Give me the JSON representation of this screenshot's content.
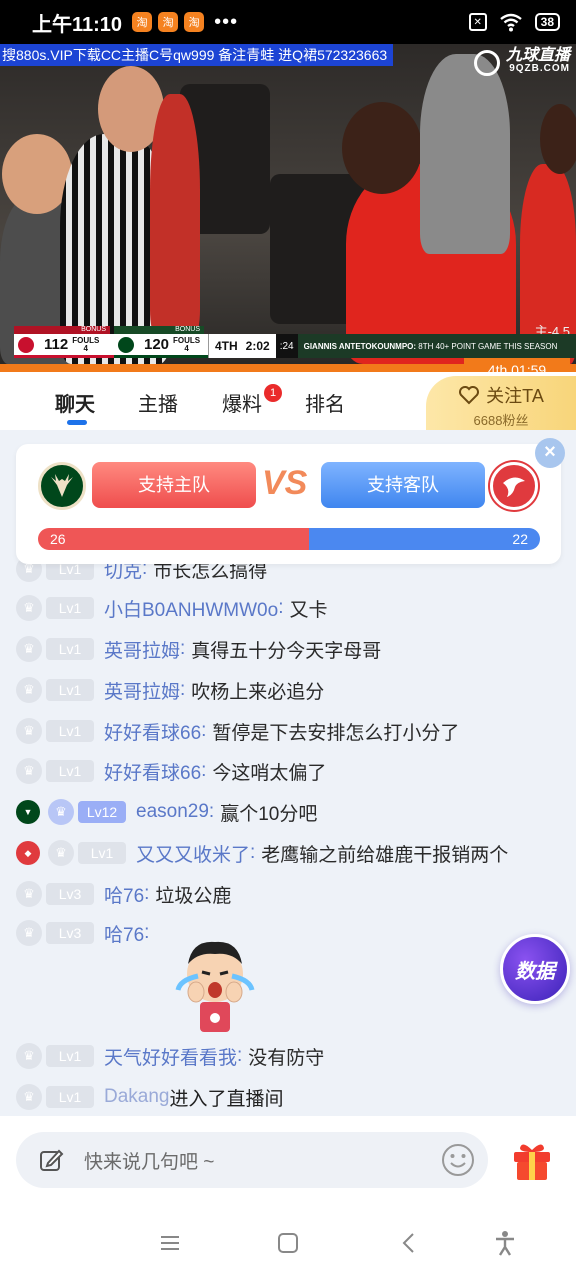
{
  "status": {
    "time": "上午11:10",
    "app_icons": [
      "淘",
      "淘",
      "淘"
    ],
    "dots": "•••",
    "battery": "38"
  },
  "video": {
    "ticker": "搜880s.VIP下载CC主播C号qw999 备注青蛙 进Q裙572323663",
    "watermark_title": "九球直播",
    "watermark_url": "9QZB.COM",
    "scorebug": {
      "away_score": "112",
      "away_fouls_label": "FOULS",
      "away_fouls": "4",
      "home_score": "120",
      "home_fouls_label": "FOULS",
      "home_fouls": "4",
      "away_bonus": "BONUS",
      "home_bonus": "BONUS",
      "period": "4TH",
      "clock": "2:02",
      "shot_clock": ":24",
      "note_name": "GIANNIS ANTETOKOUNMPO:",
      "note_text": "8TH 40+ POINT GAME THIS SEASON"
    },
    "odds": "主-4.5"
  },
  "game_clock": "4th 01:59",
  "tabs": [
    {
      "label": "聊天"
    },
    {
      "label": "主播"
    },
    {
      "label": "爆料",
      "badge": "1"
    },
    {
      "label": "排名"
    }
  ],
  "follow": {
    "label": "关注TA",
    "fans": "6688粉丝"
  },
  "vote": {
    "home_label": "支持主队",
    "away_label": "支持客队",
    "vs": "VS",
    "home_votes": "26",
    "away_votes": "22",
    "home_share": 0.54,
    "close": "×"
  },
  "messages": [
    {
      "level": "Lv1",
      "user": "切克",
      "text": "市长怎么搞得"
    },
    {
      "level": "Lv1",
      "user": "小白B0ANHWMW0o",
      "text": "又卡"
    },
    {
      "level": "Lv1",
      "user": "英哥拉姆",
      "text": "真得五十分今天字母哥"
    },
    {
      "level": "Lv1",
      "user": "英哥拉姆",
      "text": "吹杨上来必追分"
    },
    {
      "level": "Lv1",
      "user": "好好看球66",
      "text": "暂停是下去安排怎么打小分了"
    },
    {
      "level": "Lv1",
      "user": "好好看球66",
      "text": "今这哨太偏了"
    },
    {
      "level": "Lv12",
      "user": "eason29",
      "text": "赢个10分吧"
    },
    {
      "level": "Lv1",
      "user": "又又又收米了",
      "text": "老鹰输之前给雄鹿干报销两个"
    },
    {
      "level": "Lv3",
      "user": "哈76",
      "text": "垃圾公鹿"
    },
    {
      "level": "Lv3",
      "user": "哈76",
      "text": ""
    },
    {
      "level": "Lv1",
      "user": "天气好好看看我",
      "text": "没有防守"
    },
    {
      "level": "Lv1",
      "user": "Dakang",
      "text": "进入了直播间"
    }
  ],
  "data_button": "数据",
  "input": {
    "placeholder": "快来说几句吧 ~"
  },
  "colors": {
    "accent_blue": "#1d72ea",
    "orange": "#f27a1a",
    "home_red": "#ef5656",
    "away_blue": "#4b88f0"
  },
  "icons": [
    "edit-icon",
    "smile-icon",
    "gift-icon",
    "heart-icon",
    "menu-icon",
    "home-icon",
    "back-icon",
    "accessibility-icon"
  ]
}
